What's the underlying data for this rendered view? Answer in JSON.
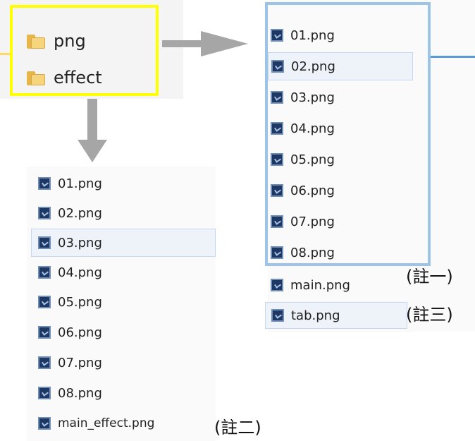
{
  "folders": [
    {
      "name": "png",
      "icon": "folder-icon"
    },
    {
      "name": "effect",
      "icon": "folder-icon"
    }
  ],
  "png_folder_files": [
    {
      "name": "01.png",
      "selected": false
    },
    {
      "name": "02.png",
      "selected": true
    },
    {
      "name": "03.png",
      "selected": false
    },
    {
      "name": "04.png",
      "selected": false
    },
    {
      "name": "05.png",
      "selected": false
    },
    {
      "name": "06.png",
      "selected": false
    },
    {
      "name": "07.png",
      "selected": false
    },
    {
      "name": "08.png",
      "selected": false
    },
    {
      "name": "main.png",
      "selected": false,
      "note": "(註一)"
    },
    {
      "name": "tab.png",
      "selected": true,
      "note": "(註三)"
    }
  ],
  "effect_folder_files": [
    {
      "name": "01.png",
      "selected": false
    },
    {
      "name": "02.png",
      "selected": false
    },
    {
      "name": "03.png",
      "selected": true
    },
    {
      "name": "04.png",
      "selected": false
    },
    {
      "name": "05.png",
      "selected": false
    },
    {
      "name": "06.png",
      "selected": false
    },
    {
      "name": "07.png",
      "selected": false
    },
    {
      "name": "08.png",
      "selected": false
    },
    {
      "name": "main_effect.png",
      "selected": false,
      "note": "(註二)"
    }
  ],
  "colors": {
    "highlight_png_folder": "#ffff00",
    "highlight_png_files": "#9dc3e6",
    "arrow": "#a6a6a6",
    "file_icon": "#1f3763"
  }
}
